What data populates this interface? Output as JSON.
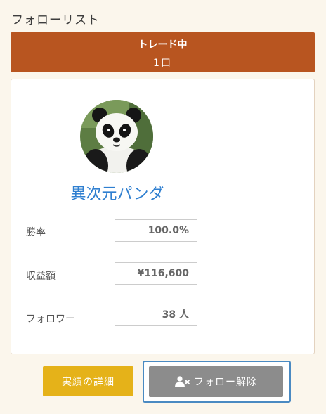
{
  "page_title": "フォローリスト",
  "trade_banner": {
    "title": "トレード中",
    "count": "1口"
  },
  "trader": {
    "name": "異次元パンダ",
    "avatar_icon": "panda-avatar"
  },
  "stats": [
    {
      "label": "勝率",
      "value": "100.0%"
    },
    {
      "label": "収益額",
      "value": "¥116,600"
    },
    {
      "label": "フォロワー",
      "value": "38 人"
    }
  ],
  "buttons": {
    "history_label": "実績の詳細",
    "unfollow_label": "フォロー解除",
    "unfollow_icon": "user-remove-icon"
  },
  "colors": {
    "banner": "#b85520",
    "history_button": "#e5b219",
    "unfollow_button": "#8c8c8c",
    "name_link": "#2f7fd0",
    "focus_ring": "#4a8ac2"
  }
}
